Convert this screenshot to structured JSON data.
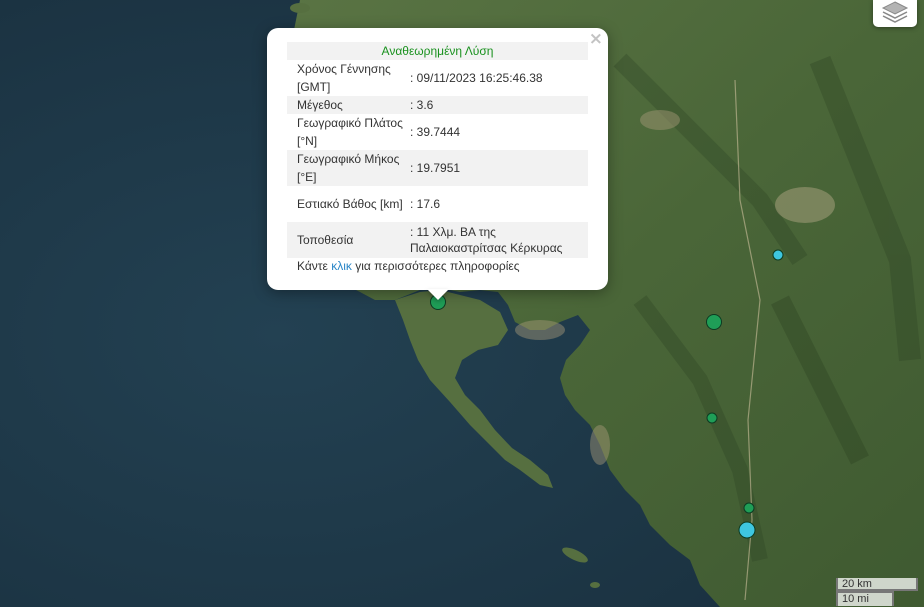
{
  "popup": {
    "title": "Αναθεωρημένη Λύση",
    "rows": [
      {
        "label": "Χρόνος Γέννησης [GMT]",
        "value": ": 09/11/2023 16:25:46.38"
      },
      {
        "label": "Μέγεθος",
        "value": ": 3.6"
      },
      {
        "label": "Γεωγραφικό Πλάτος [°N]",
        "value": ": 39.7444"
      },
      {
        "label": "Γεωγραφικό Μήκος [°E]",
        "value": ": 19.7951"
      },
      {
        "label": "Εστιακό Βάθος [km]",
        "value": ": 17.6"
      },
      {
        "label": "Τοποθεσία",
        "value": ": 11 Χλμ. ΒΑ της Παλαιοκαστρίτσας Κέρκυρας"
      }
    ],
    "more_prefix": "Κάντε ",
    "more_link": "κλικ",
    "more_suffix": " για περισσότερες πληροφορίες",
    "close_symbol": "×"
  },
  "scale": {
    "km": "20 km",
    "mi": "10 mi"
  },
  "colors": {
    "sea": "#1f3848",
    "land": "#4d6a3c",
    "quake_green": "#1f9e57",
    "quake_cyan": "#3ec6e0",
    "revised_text": "#19911e",
    "link": "#2a86c7"
  },
  "icons": {
    "layers": "layers-icon",
    "close": "close-icon"
  }
}
